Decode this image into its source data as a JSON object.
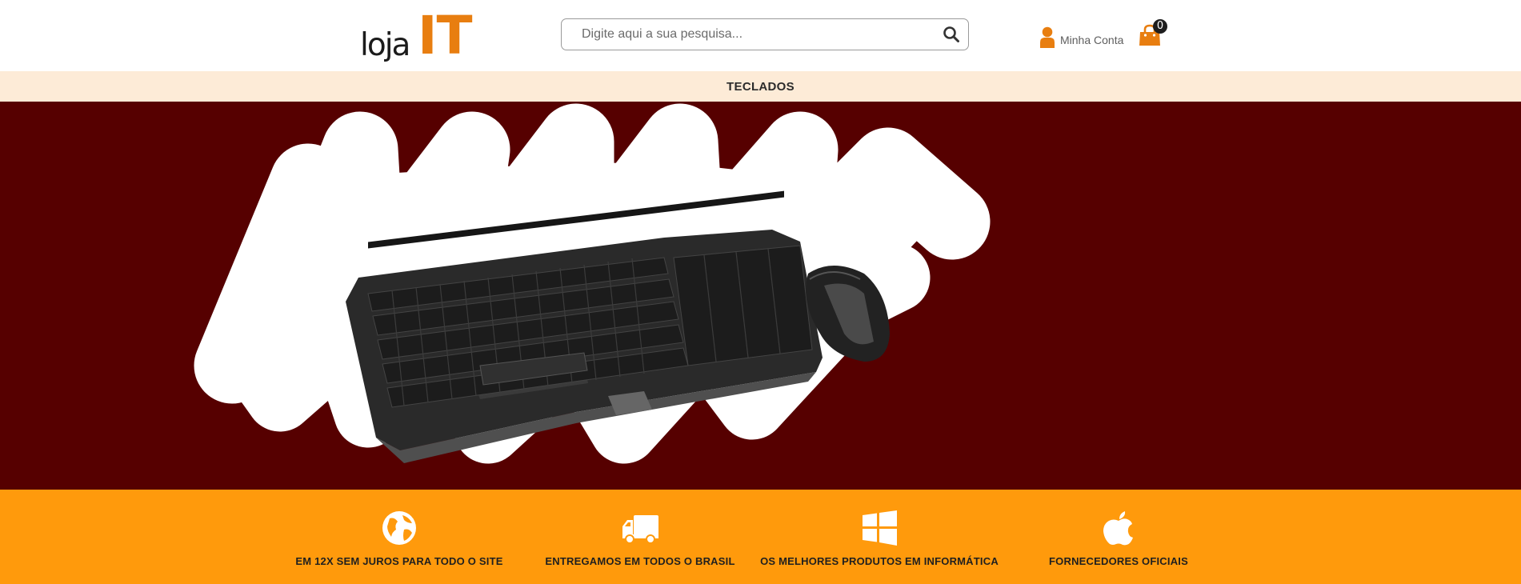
{
  "header": {
    "logo": {
      "text_loja": "loja",
      "text_it": "IT"
    },
    "search": {
      "placeholder": "Digite aqui a sua pesquisa...",
      "value": "",
      "button_icon": "search-icon"
    },
    "account": {
      "label": "Minha Conta",
      "icon": "user-icon"
    },
    "cart": {
      "count": "0",
      "icon": "shopping-bag-icon"
    }
  },
  "nav": {
    "categories": [
      {
        "label": "TECLADOS"
      }
    ]
  },
  "hero": {
    "background_color": "#560000",
    "image": "keyboard-and-mouse-product-illustration"
  },
  "features": [
    {
      "icon": "globe-icon",
      "label": "EM 12X SEM JUROS PARA TODO O SITE"
    },
    {
      "icon": "truck-icon",
      "label": "ENTREGAMOS EM TODOS O BRASIL"
    },
    {
      "icon": "windows-icon",
      "label": "OS MELHORES PRODUTOS EM INFORMÁTICA"
    },
    {
      "icon": "apple-icon",
      "label": "FORNECEDORES OFICIAIS"
    }
  ],
  "colors": {
    "brand_orange": "#e87e10",
    "features_bar": "#ff9a0c",
    "nav_bar": "#fdebd7",
    "hero_bg": "#560000"
  }
}
